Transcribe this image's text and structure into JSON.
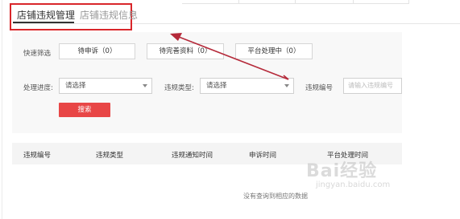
{
  "tabs": [
    {
      "label": "店铺违规管理",
      "active": true
    },
    {
      "label": "店铺违规信息",
      "active": false
    }
  ],
  "quick_filter": {
    "label": "快速筛选",
    "buttons": [
      "待申诉（0）",
      "待完善资料（0）",
      "平台处理中（0）"
    ]
  },
  "filters": {
    "progress_label": "处理进度:",
    "progress_value": "请选择",
    "type_label": "违规类型:",
    "type_value": "请选择",
    "id_label": "违规编号",
    "id_placeholder": "请输入违规编号"
  },
  "search_label": "搜索",
  "table": {
    "columns": [
      "违规编号",
      "违规类型",
      "违规通知时间",
      "申诉时间",
      "平台处理时间"
    ],
    "empty_text": "没有查询到相应的数据"
  },
  "watermark": {
    "text": "Bai经验",
    "sub": "jingyan.baidu.com"
  },
  "colors": {
    "highlight": "#d9262a",
    "search_button": "#e84646",
    "arrow": "#b52a3a"
  }
}
